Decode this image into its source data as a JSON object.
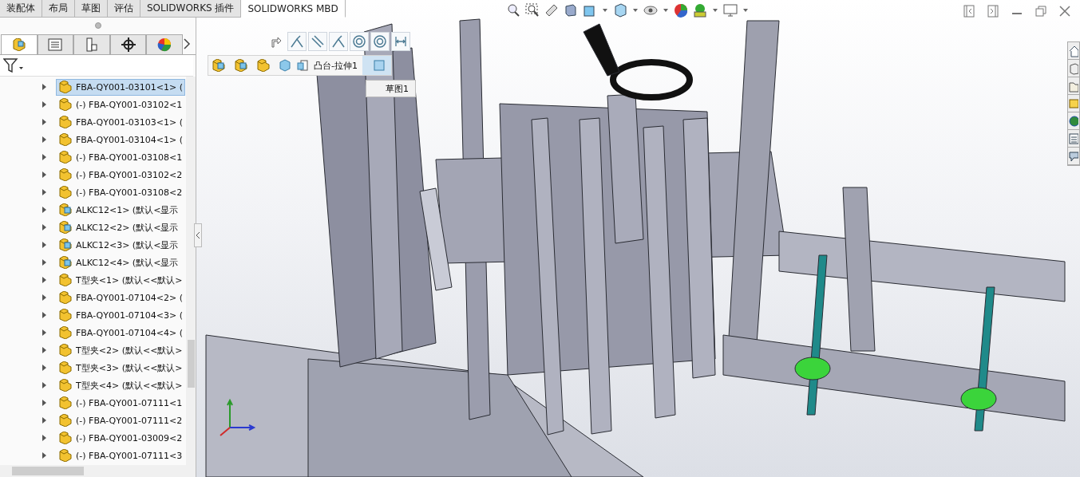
{
  "tabs": [
    {
      "label": "装配体",
      "selected": false
    },
    {
      "label": "布局",
      "selected": false
    },
    {
      "label": "草图",
      "selected": false
    },
    {
      "label": "评估",
      "selected": false
    },
    {
      "label": "SOLIDWORKS 插件",
      "selected": false
    },
    {
      "label": "SOLIDWORKS MBD",
      "selected": true
    }
  ],
  "feature_tree": {
    "items": [
      {
        "kind": "part",
        "label": "FBA-QY001-03101<1> (",
        "selected": true
      },
      {
        "kind": "part",
        "label": "(-) FBA-QY001-03102<1",
        "selected": false
      },
      {
        "kind": "part",
        "label": "FBA-QY001-03103<1> (",
        "selected": false
      },
      {
        "kind": "part",
        "label": "FBA-QY001-03104<1> (",
        "selected": false
      },
      {
        "kind": "part",
        "label": "(-) FBA-QY001-03108<1",
        "selected": false
      },
      {
        "kind": "part",
        "label": "(-) FBA-QY001-03102<2",
        "selected": false
      },
      {
        "kind": "part",
        "label": "(-) FBA-QY001-03108<2",
        "selected": false
      },
      {
        "kind": "assembly",
        "label": "ALKC12<1> (默认<显示",
        "selected": false
      },
      {
        "kind": "assembly",
        "label": "ALKC12<2> (默认<显示",
        "selected": false
      },
      {
        "kind": "assembly",
        "label": "ALKC12<3> (默认<显示",
        "selected": false
      },
      {
        "kind": "assembly",
        "label": "ALKC12<4> (默认<显示",
        "selected": false
      },
      {
        "kind": "part",
        "label": "T型夹<1> (默认<<默认>",
        "selected": false
      },
      {
        "kind": "part",
        "label": "FBA-QY001-07104<2> (",
        "selected": false
      },
      {
        "kind": "part",
        "label": "FBA-QY001-07104<3> (",
        "selected": false
      },
      {
        "kind": "part",
        "label": "FBA-QY001-07104<4> (",
        "selected": false
      },
      {
        "kind": "part",
        "label": "T型夹<2> (默认<<默认>",
        "selected": false
      },
      {
        "kind": "part",
        "label": "T型夹<3> (默认<<默认>",
        "selected": false
      },
      {
        "kind": "part",
        "label": "T型夹<4> (默认<<默认>",
        "selected": false
      },
      {
        "kind": "part",
        "label": "(-) FBA-QY001-07111<1",
        "selected": false
      },
      {
        "kind": "part",
        "label": "(-) FBA-QY001-07111<2",
        "selected": false
      },
      {
        "kind": "part",
        "label": "(-) FBA-QY001-03009<2",
        "selected": false
      },
      {
        "kind": "part",
        "label": "(-) FBA-QY001-07111<3",
        "selected": false
      }
    ]
  },
  "panel_tabs": [
    {
      "selected": true
    },
    {
      "selected": false
    },
    {
      "selected": false
    },
    {
      "selected": false
    },
    {
      "selected": false
    }
  ],
  "breadcrumb": {
    "feature": "凸台-拉伸1"
  },
  "sketch_popup": {
    "label": "草图1"
  }
}
